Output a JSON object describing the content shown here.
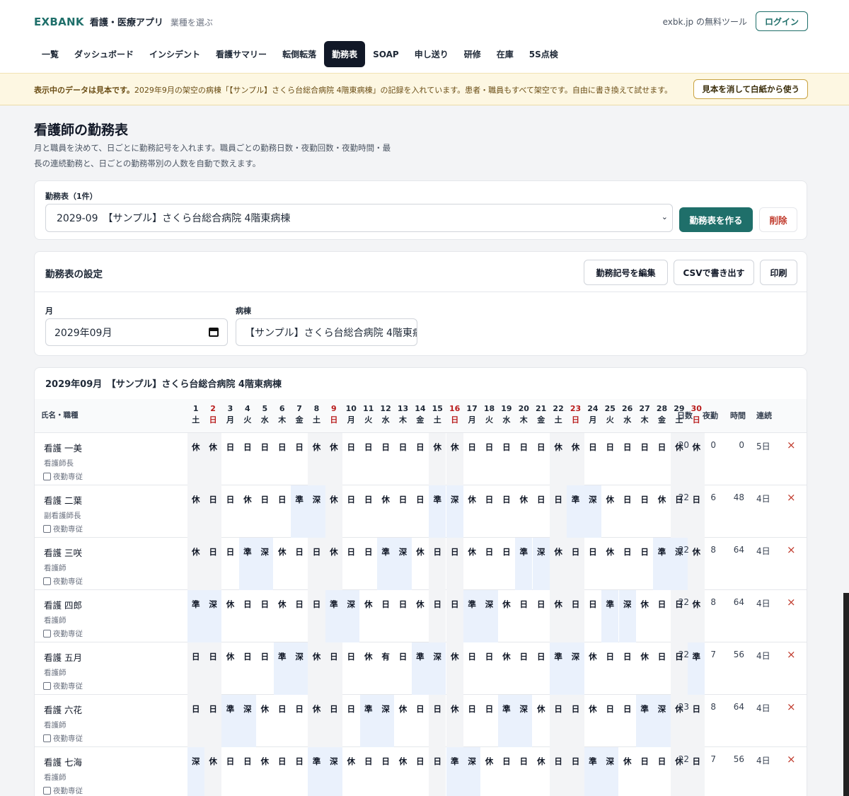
{
  "header": {
    "logo": "EXBANK",
    "app": "看護・医療アプリ",
    "picker": "業種を選ぶ",
    "tool_link": "exbk.jp の無料ツール",
    "login": "ログイン"
  },
  "nav": [
    "一覧",
    "ダッシュボード",
    "インシデント",
    "看護サマリー",
    "転倒転落",
    "勤務表",
    "SOAP",
    "申し送り",
    "研修",
    "在庫",
    "5S点検"
  ],
  "nav_active": 5,
  "notice": {
    "bold": "表示中のデータは見本です。",
    "text": "2029年9月の架空の病棟「【サンプル】さくら台総合病院 4階東病棟」の記録を入れています。患者・職員もすべて架空です。自由に書き換えて試せます。",
    "button": "見本を消して白紙から使う"
  },
  "page": {
    "title": "看護師の勤務表",
    "desc": "月と職員を決めて、日ごとに勤務記号を入れます。職員ごとの勤務日数・夜勤回数・夜勤時間・最長の連続勤務と、日ごとの勤務帯別の人数を自動で数えます。"
  },
  "select_card": {
    "label": "勤務表（1件）",
    "selected": "2029-09　【サンプル】さくら台総合病院 4階東病棟",
    "create": "勤務表を作る",
    "delete": "削除"
  },
  "settings": {
    "title": "勤務表の設定",
    "edit_codes": "勤務記号を編集",
    "csv": "CSVで書き出す",
    "print": "印刷",
    "month_label": "月",
    "month_value": "2029年09月",
    "ward_label": "病棟",
    "ward_value": "【サンプル】さくら台総合病院 4階東病棟"
  },
  "grid": {
    "title": "2029年09月　【サンプル】さくら台総合病院 4階東病棟",
    "name_header": "氏名・職種",
    "stat_headers": [
      "日数",
      "夜勤",
      "時間",
      "連続"
    ],
    "night_label": "夜勤専従",
    "days": [
      {
        "d": "1",
        "w": "土"
      },
      {
        "d": "2",
        "w": "日"
      },
      {
        "d": "3",
        "w": "月"
      },
      {
        "d": "4",
        "w": "火"
      },
      {
        "d": "5",
        "w": "水"
      },
      {
        "d": "6",
        "w": "木"
      },
      {
        "d": "7",
        "w": "金"
      },
      {
        "d": "8",
        "w": "土"
      },
      {
        "d": "9",
        "w": "日"
      },
      {
        "d": "10",
        "w": "月"
      },
      {
        "d": "11",
        "w": "火"
      },
      {
        "d": "12",
        "w": "水"
      },
      {
        "d": "13",
        "w": "木"
      },
      {
        "d": "14",
        "w": "金"
      },
      {
        "d": "15",
        "w": "土"
      },
      {
        "d": "16",
        "w": "日"
      },
      {
        "d": "17",
        "w": "月"
      },
      {
        "d": "18",
        "w": "火"
      },
      {
        "d": "19",
        "w": "水"
      },
      {
        "d": "20",
        "w": "木"
      },
      {
        "d": "21",
        "w": "金"
      },
      {
        "d": "22",
        "w": "土"
      },
      {
        "d": "23",
        "w": "日"
      },
      {
        "d": "24",
        "w": "月"
      },
      {
        "d": "25",
        "w": "火"
      },
      {
        "d": "26",
        "w": "水"
      },
      {
        "d": "27",
        "w": "木"
      },
      {
        "d": "28",
        "w": "金"
      },
      {
        "d": "29",
        "w": "土"
      },
      {
        "d": "30",
        "w": "日"
      }
    ],
    "rows": [
      {
        "name": "看護 一美",
        "role": "看護師長",
        "shifts": [
          "休",
          "休",
          "日",
          "日",
          "日",
          "日",
          "日",
          "休",
          "休",
          "日",
          "日",
          "日",
          "日",
          "日",
          "休",
          "休",
          "日",
          "日",
          "日",
          "日",
          "日",
          "休",
          "休",
          "日",
          "日",
          "日",
          "日",
          "日",
          "休",
          "休"
        ],
        "days": "20",
        "night": "0",
        "hours": "0",
        "consec": "5日"
      },
      {
        "name": "看護 二葉",
        "role": "副看護師長",
        "shifts": [
          "休",
          "日",
          "日",
          "休",
          "日",
          "日",
          "準",
          "深",
          "休",
          "日",
          "日",
          "休",
          "日",
          "日",
          "準",
          "深",
          "休",
          "日",
          "日",
          "休",
          "日",
          "日",
          "準",
          "深",
          "休",
          "日",
          "日",
          "休",
          "日",
          "日"
        ],
        "days": "22",
        "night": "6",
        "hours": "48",
        "consec": "4日"
      },
      {
        "name": "看護 三咲",
        "role": "看護師",
        "shifts": [
          "休",
          "日",
          "日",
          "準",
          "深",
          "休",
          "日",
          "日",
          "休",
          "日",
          "日",
          "準",
          "深",
          "休",
          "日",
          "日",
          "休",
          "日",
          "日",
          "準",
          "深",
          "休",
          "日",
          "日",
          "休",
          "日",
          "日",
          "準",
          "深",
          "休"
        ],
        "days": "22",
        "night": "8",
        "hours": "64",
        "consec": "4日"
      },
      {
        "name": "看護 四郎",
        "role": "看護師",
        "shifts": [
          "準",
          "深",
          "休",
          "日",
          "日",
          "休",
          "日",
          "日",
          "準",
          "深",
          "休",
          "日",
          "日",
          "休",
          "日",
          "日",
          "準",
          "深",
          "休",
          "日",
          "日",
          "休",
          "日",
          "日",
          "準",
          "深",
          "休",
          "日",
          "日",
          "休"
        ],
        "days": "22",
        "night": "8",
        "hours": "64",
        "consec": "4日"
      },
      {
        "name": "看護 五月",
        "role": "看護師",
        "shifts": [
          "日",
          "日",
          "休",
          "日",
          "日",
          "準",
          "深",
          "休",
          "日",
          "日",
          "休",
          "有",
          "日",
          "準",
          "深",
          "休",
          "日",
          "日",
          "休",
          "日",
          "日",
          "準",
          "深",
          "休",
          "日",
          "日",
          "休",
          "日",
          "日",
          "準"
        ],
        "days": "22",
        "night": "7",
        "hours": "56",
        "consec": "4日"
      },
      {
        "name": "看護 六花",
        "role": "看護師",
        "shifts": [
          "日",
          "日",
          "準",
          "深",
          "休",
          "日",
          "日",
          "休",
          "日",
          "日",
          "準",
          "深",
          "休",
          "日",
          "日",
          "休",
          "日",
          "日",
          "準",
          "深",
          "休",
          "日",
          "日",
          "休",
          "日",
          "日",
          "準",
          "深",
          "休",
          "日"
        ],
        "days": "23",
        "night": "8",
        "hours": "64",
        "consec": "4日"
      },
      {
        "name": "看護 七海",
        "role": "看護師",
        "shifts": [
          "深",
          "休",
          "日",
          "日",
          "休",
          "日",
          "日",
          "準",
          "深",
          "休",
          "日",
          "日",
          "休",
          "日",
          "日",
          "準",
          "深",
          "休",
          "日",
          "日",
          "休",
          "日",
          "日",
          "準",
          "深",
          "休",
          "日",
          "日",
          "休",
          "日"
        ],
        "days": "22",
        "night": "7",
        "hours": "56",
        "consec": "4日"
      }
    ]
  }
}
